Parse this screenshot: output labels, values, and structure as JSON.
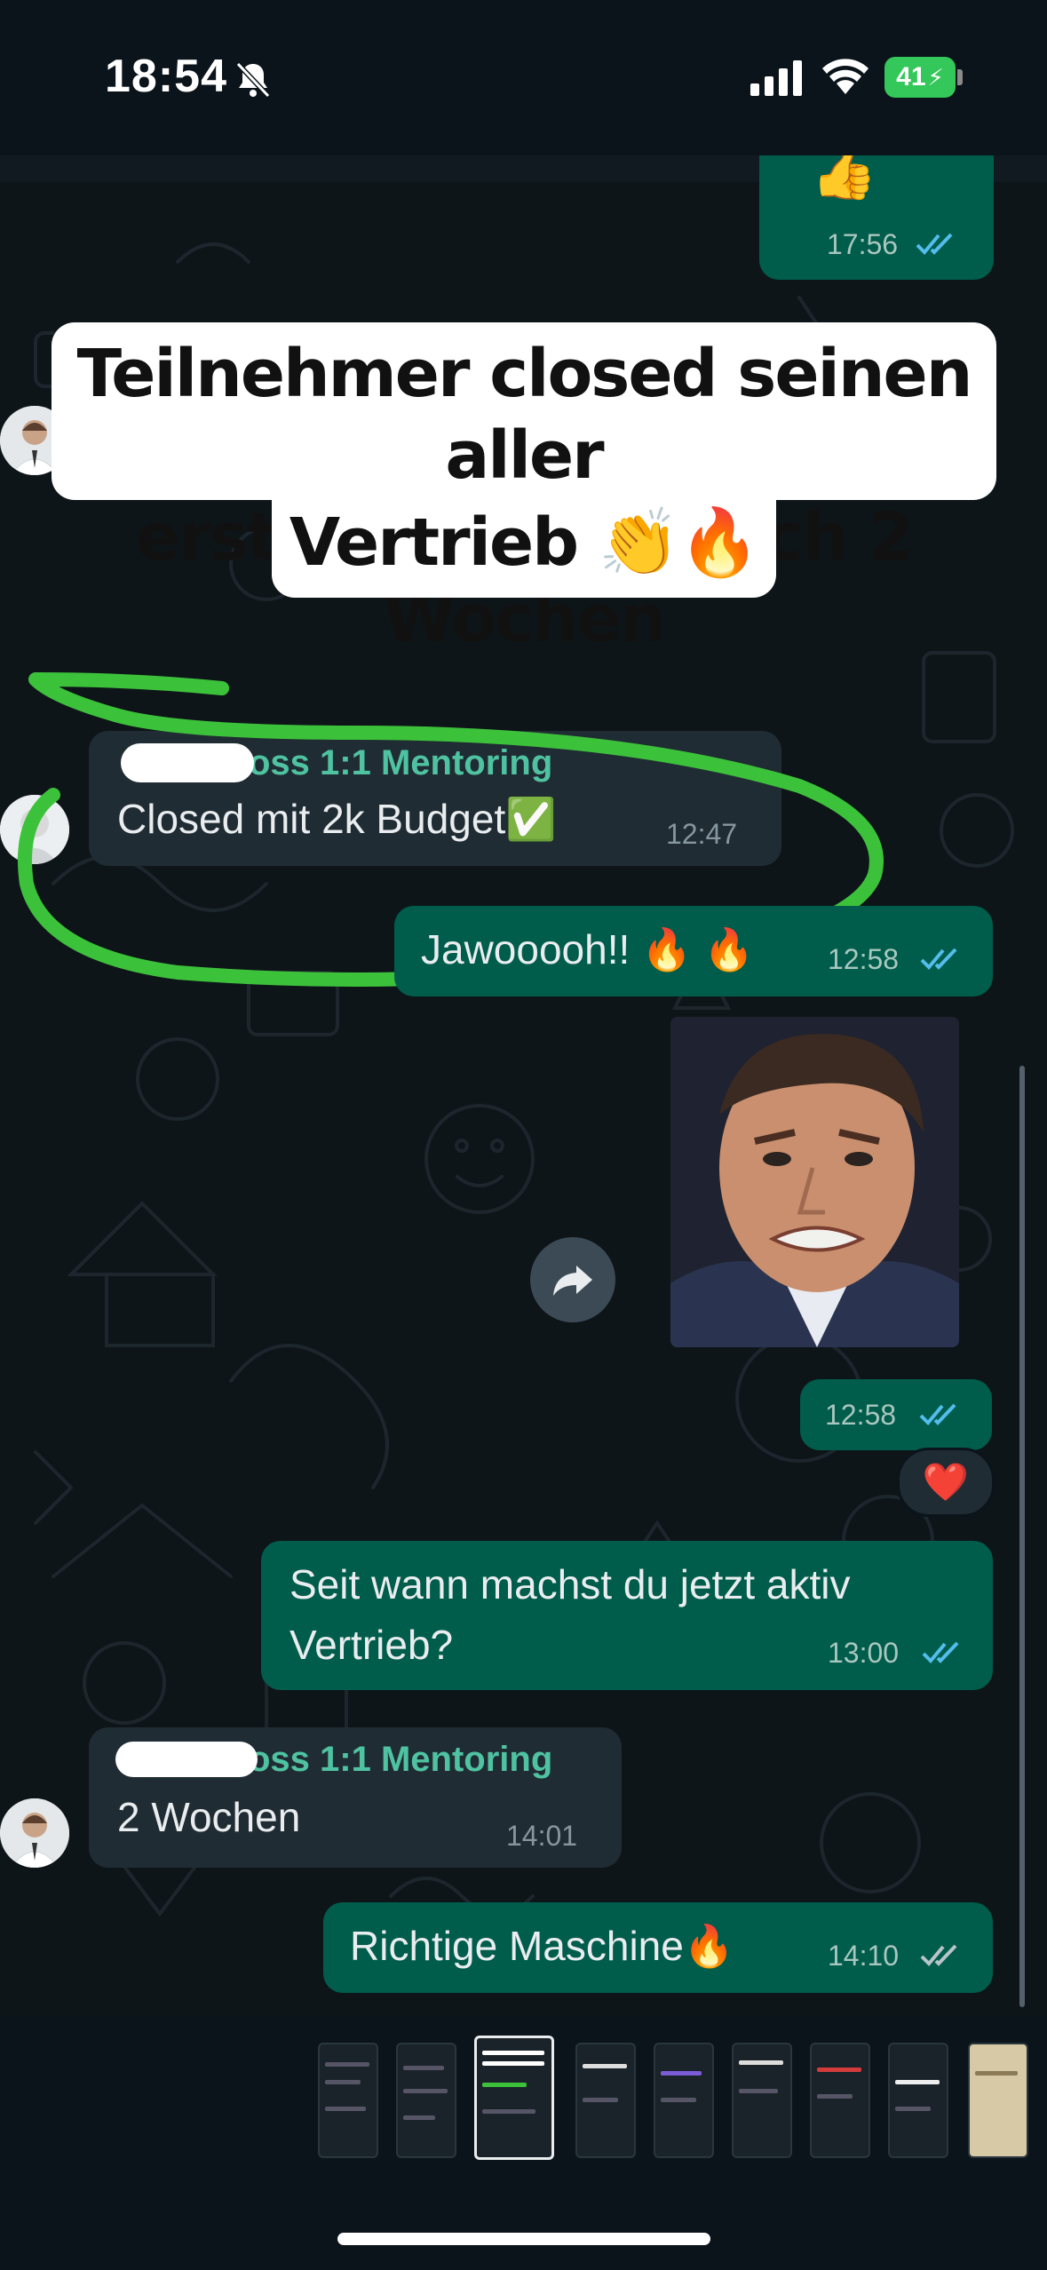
{
  "status_bar": {
    "time": "18:54",
    "battery": "41"
  },
  "overlay_caption": {
    "line1": "Teilnehmer closed seinen aller",
    "line2": "ersten Kunden nach 2 Wochen",
    "line3": "Vertrieb 👏🔥"
  },
  "messages": {
    "m0": {
      "text": "👍",
      "time": "17:56",
      "direction": "out",
      "read": true
    },
    "m1": {
      "sender": "oss 1:1 Mentoring",
      "text": "Closed mit 2k Budget✅",
      "time": "12:47",
      "direction": "in"
    },
    "m2": {
      "text": "Jawooooh!! 🔥 🔥",
      "time": "12:58",
      "direction": "out",
      "read": true
    },
    "m3": {
      "time": "12:58",
      "direction": "out",
      "type": "sticker",
      "read": true,
      "reaction": "❤️"
    },
    "m4": {
      "line1": "Seit wann machst du jetzt aktiv",
      "line2": "Vertrieb?",
      "time": "13:00",
      "direction": "out",
      "read": true
    },
    "m5": {
      "sender": "oss 1:1 Mentoring",
      "text": "2 Wochen",
      "time": "14:01",
      "direction": "in"
    },
    "m6": {
      "text": "Richtige Maschine🔥",
      "time": "14:10",
      "direction": "out",
      "read": false
    }
  },
  "icons": {
    "bell": "bell-slash-icon",
    "signal": "cellular-signal-icon",
    "wifi": "wifi-icon",
    "forward": "forward-icon",
    "ticks": "double-check-icon"
  },
  "colors": {
    "outgoing_bubble": "#005c4b",
    "incoming_bubble": "#202c33",
    "read_ticks": "#53bdeb",
    "highlight_circle": "#3cc23a",
    "sender_name": "#4fc3a1"
  }
}
